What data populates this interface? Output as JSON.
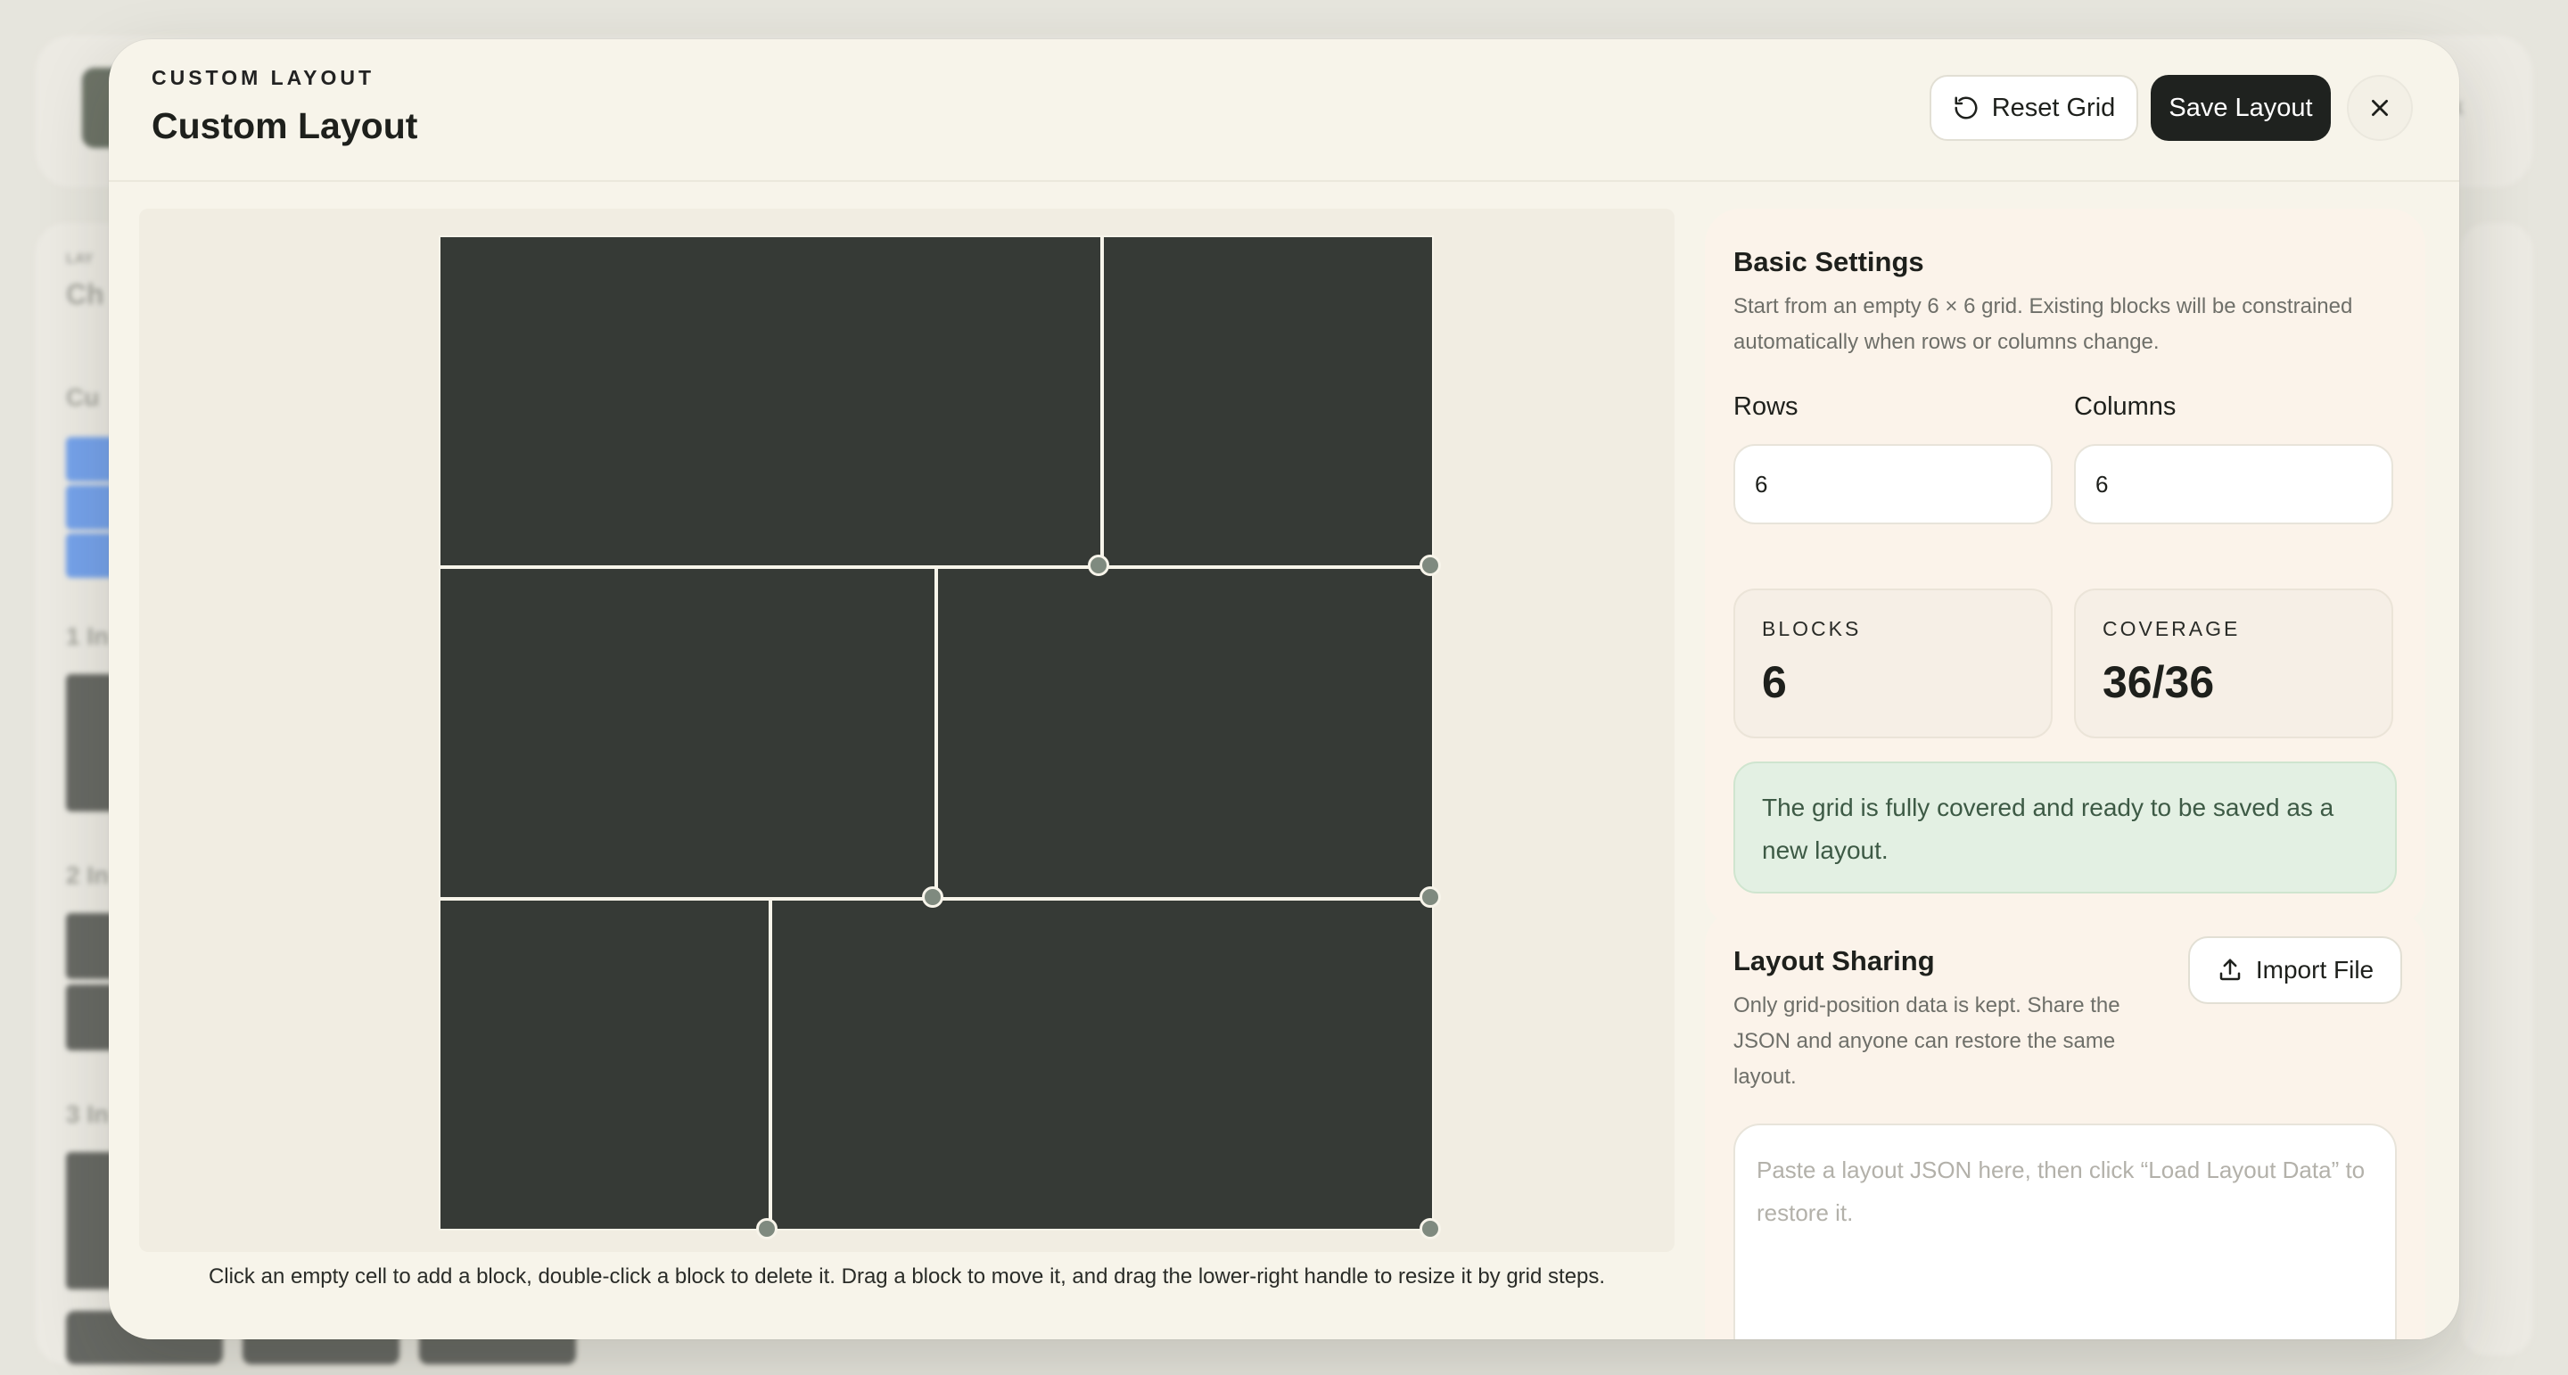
{
  "background": {
    "top_right_text": "k",
    "left_labels": [
      "LAY",
      "Ch",
      "Cu",
      "1 In",
      "2 In",
      "3 In"
    ]
  },
  "modal": {
    "eyebrow": "CUSTOM LAYOUT",
    "title": "Custom Layout",
    "reset_label": "Reset Grid",
    "save_label": "Save Layout",
    "close_icon": "close-icon",
    "reset_icon": "rotate-ccw-icon"
  },
  "canvas": {
    "rows": 6,
    "columns": 6,
    "blocks": [
      {
        "row": 0,
        "col": 0,
        "rowSpan": 2,
        "colSpan": 4
      },
      {
        "row": 0,
        "col": 4,
        "rowSpan": 2,
        "colSpan": 2
      },
      {
        "row": 2,
        "col": 0,
        "rowSpan": 2,
        "colSpan": 3
      },
      {
        "row": 2,
        "col": 3,
        "rowSpan": 2,
        "colSpan": 3
      },
      {
        "row": 4,
        "col": 0,
        "rowSpan": 2,
        "colSpan": 2
      },
      {
        "row": 4,
        "col": 2,
        "rowSpan": 2,
        "colSpan": 4
      }
    ],
    "block_color": "#363a36",
    "handle_color": "#7f8a7f",
    "hint": "Click an empty cell to add a block, double-click a block to delete it. Drag a block to move it, and drag the lower-right handle to resize it by grid steps."
  },
  "basic_settings": {
    "title": "Basic Settings",
    "description": "Start from an empty 6 × 6 grid. Existing blocks will be constrained automatically when rows or columns change.",
    "rows_label": "Rows",
    "rows_value": "6",
    "columns_label": "Columns",
    "columns_value": "6",
    "blocks_label": "BLOCKS",
    "blocks_value": "6",
    "coverage_label": "COVERAGE",
    "coverage_value": "36/36",
    "status": "The grid is fully covered and ready to be saved as a new layout."
  },
  "layout_sharing": {
    "title": "Layout Sharing",
    "description": "Only grid-position data is kept. Share the JSON and anyone can restore the same layout.",
    "import_label": "Import File",
    "import_icon": "upload-icon",
    "json_placeholder": "Paste a layout JSON here, then click “Load Layout Data” to restore it."
  }
}
